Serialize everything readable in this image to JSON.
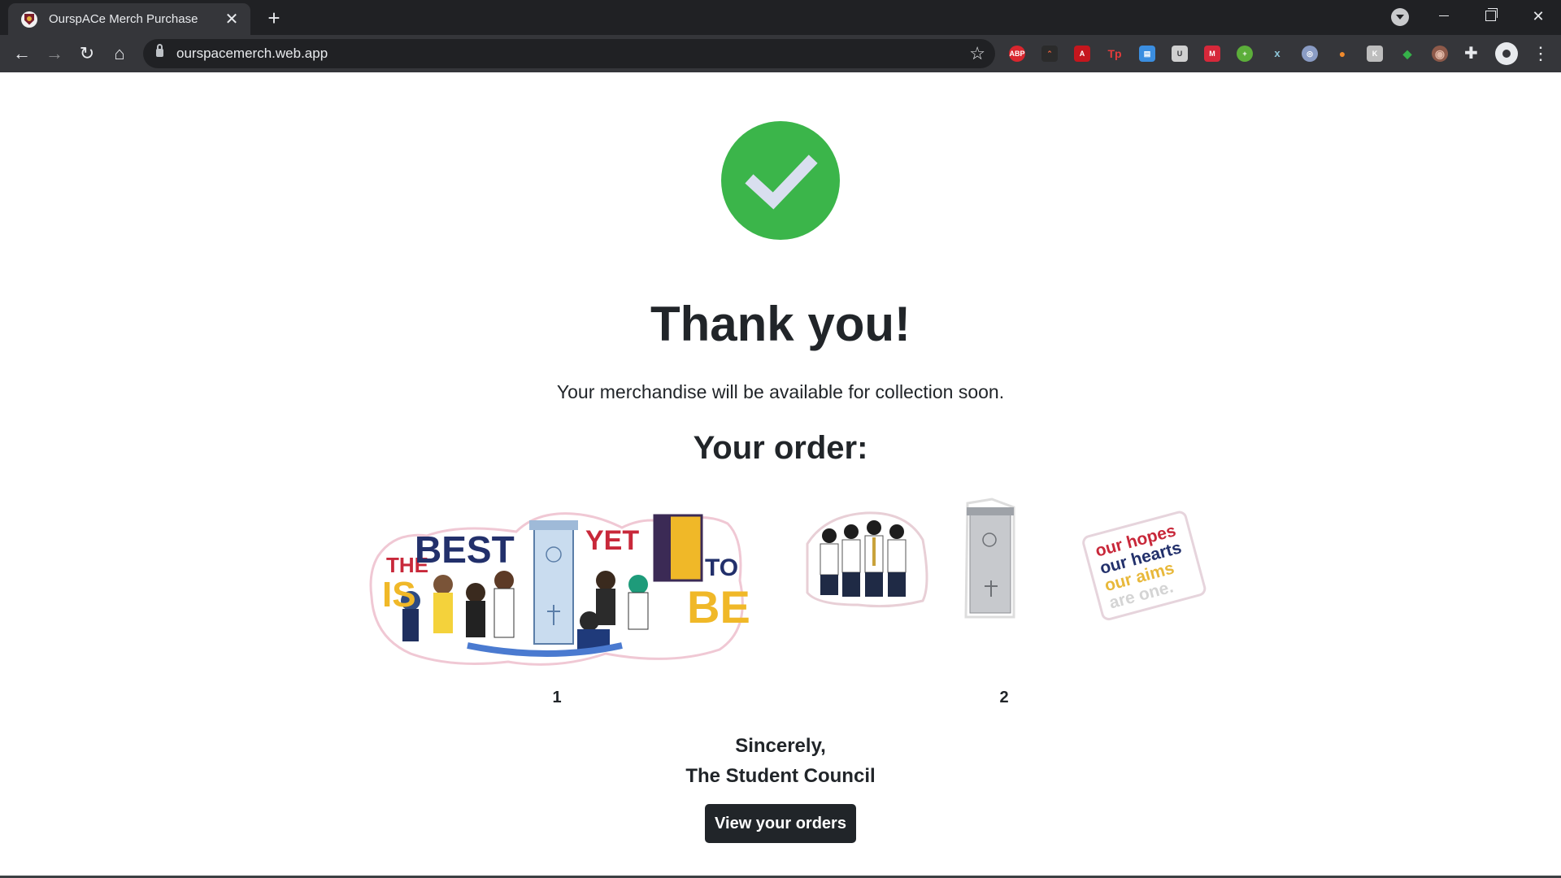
{
  "browser": {
    "tab_title": "OurspACe Merch Purchase",
    "tab_close": "✕",
    "new_tab": "+",
    "url": "ourspacemerch.web.app",
    "nav": {
      "back": "←",
      "forward": "→",
      "reload": "↻",
      "home": "⌂"
    },
    "bookmark_star": "☆",
    "extensions": [
      "ABP",
      "⌃",
      "A",
      "Tp",
      "▤",
      "U",
      "M",
      "+",
      "x",
      "◎",
      "●",
      "K",
      "◆",
      "◉"
    ],
    "puzzle": "✚",
    "menu": "⋮",
    "window": {
      "minimize": "",
      "maximize": "",
      "close": "✕"
    }
  },
  "page": {
    "heading": "Thank you!",
    "message": "Your merchandise will be available for collection soon.",
    "order_heading": "Your order:",
    "order_items": [
      {
        "name": "the-best-is-yet-to-be-sticker",
        "text_the": "THE",
        "text_is": "IS",
        "text_best": "BEST",
        "text_yet": "YET",
        "text_to": "TO",
        "text_be": "BE",
        "quantity": "1"
      },
      {
        "name": "sticker-pack",
        "hopes_lines": [
          "our hopes",
          "our hearts",
          "our aims",
          "are one."
        ],
        "quantity": "2"
      }
    ],
    "signoff_line1": "Sincerely,",
    "signoff_line2": "The Student Council",
    "view_orders_button": "View your orders"
  },
  "colors": {
    "success_green": "#3bb54a",
    "text_dark": "#212529",
    "navy": "#22306b",
    "red": "#c8283a",
    "gold": "#f0b828"
  }
}
